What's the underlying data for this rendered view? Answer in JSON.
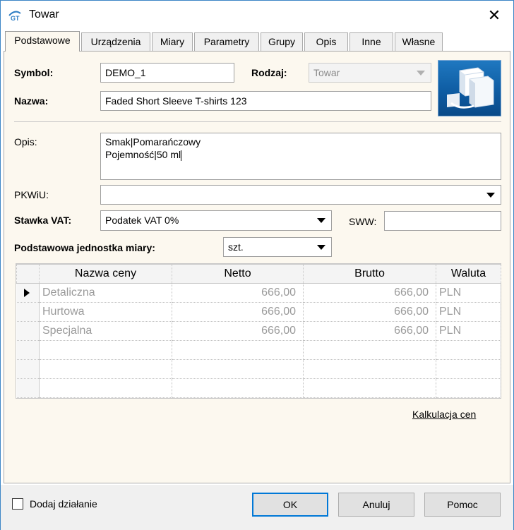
{
  "window": {
    "title": "Towar",
    "close_symbol": "✕"
  },
  "tabs": [
    {
      "label": "Podstawowe",
      "active": true
    },
    {
      "label": "Urządzenia"
    },
    {
      "label": "Miary"
    },
    {
      "label": "Parametry"
    },
    {
      "label": "Grupy"
    },
    {
      "label": "Opis"
    },
    {
      "label": "Inne"
    },
    {
      "label": "Własne"
    }
  ],
  "form": {
    "symbol_label": "Symbol:",
    "symbol_value": "DEMO_1",
    "rodzaj_label": "Rodzaj:",
    "rodzaj_value": "Towar",
    "nazwa_label": "Nazwa:",
    "nazwa_value": "Faded Short Sleeve T-shirts 123",
    "opis_label": "Opis:",
    "opis_line1": "Smak|Pomarańczowy",
    "opis_line2": "Pojemność|50 ml",
    "pkwiu_label": "PKWiU:",
    "pkwiu_value": "",
    "vat_label": "Stawka VAT:",
    "vat_value": "Podatek VAT 0%",
    "sww_label": "SWW:",
    "sww_value": "",
    "unit_label": "Podstawowa jednostka miary:",
    "unit_value": "szt."
  },
  "prices": {
    "columns": [
      "Nazwa ceny",
      "Netto",
      "Brutto",
      "Waluta"
    ],
    "rows": [
      {
        "name": "Detaliczna",
        "netto": "666,00",
        "brutto": "666,00",
        "currency": "PLN",
        "current": true
      },
      {
        "name": "Hurtowa",
        "netto": "666,00",
        "brutto": "666,00",
        "currency": "PLN"
      },
      {
        "name": "Specjalna",
        "netto": "666,00",
        "brutto": "666,00",
        "currency": "PLN"
      }
    ]
  },
  "links": {
    "calc": "Kalkulacja cen"
  },
  "footer": {
    "add_action_label": "Dodaj działanie",
    "ok_label": "OK",
    "cancel_label": "Anuluj",
    "help_label": "Pomoc"
  },
  "colors": {
    "panel_bg": "#fcf8ef",
    "accent": "#0078d7",
    "image_blue": "#1f78c0"
  }
}
